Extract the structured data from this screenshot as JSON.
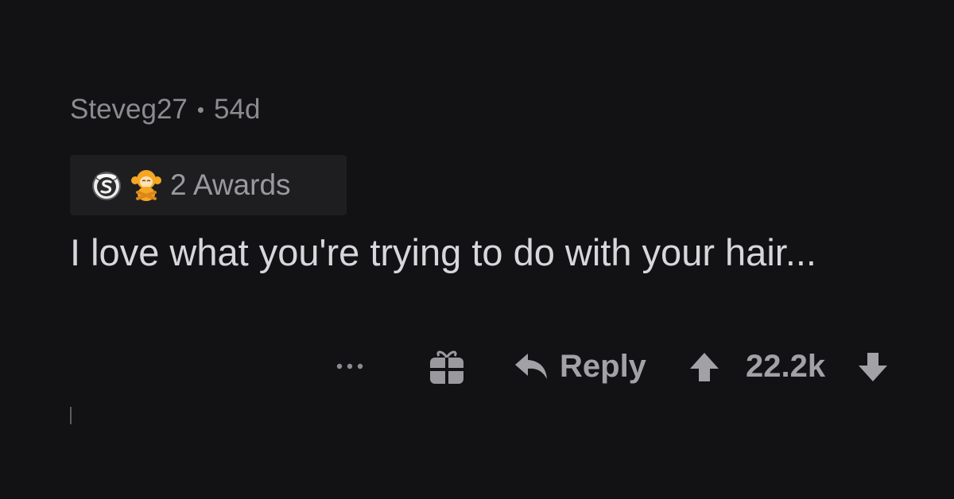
{
  "comment": {
    "author": "Steveg27",
    "separator": "•",
    "age": "54d",
    "awards": {
      "label": "2 Awards",
      "icons": [
        "silver-coin-icon",
        "monkey-award-icon"
      ]
    },
    "text": "I love what you're trying to do with your hair...",
    "actions": {
      "more_label": "...",
      "gift_icon": "gift-icon",
      "reply_label": "Reply",
      "score": "22.2k"
    }
  },
  "colors": {
    "background": "#121214",
    "award_bg": "#1e1e21",
    "text_primary": "#d7d7db",
    "text_secondary": "#8c8c90",
    "action": "#a2a2a6",
    "monkey_orange": "#f5a623"
  }
}
